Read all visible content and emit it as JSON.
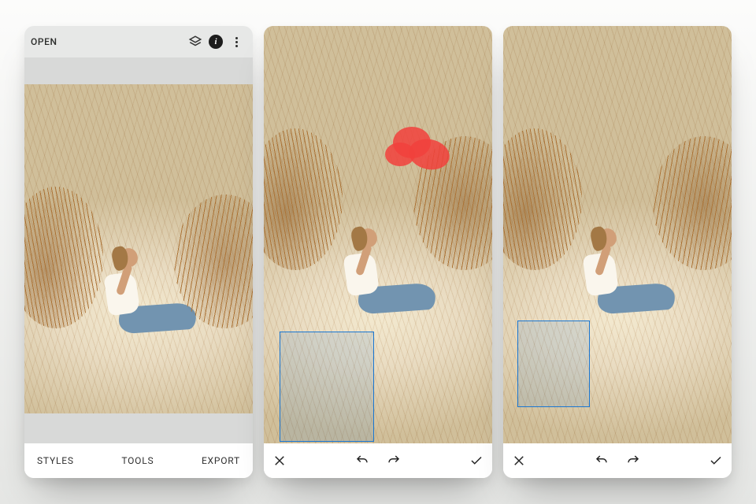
{
  "colors": {
    "mark": "#f1413d",
    "selection_stroke": "#1976d2",
    "selection_fill": "rgba(25,118,210,0.12)"
  },
  "screen1": {
    "header": {
      "open_label": "OPEN",
      "icons": {
        "layers": "layers-icon",
        "info": "info-icon",
        "more": "more-icon"
      }
    },
    "tabs": {
      "styles": "STYLES",
      "tools": "TOOLS",
      "export": "EXPORT"
    }
  },
  "screen2": {
    "compare_icon": "compare-icon",
    "action_bar": {
      "cancel": "close-icon",
      "undo": "undo-icon",
      "redo": "redo-icon",
      "apply": "check-icon"
    }
  },
  "screen3": {
    "compare_icon": "compare-icon",
    "action_bar": {
      "cancel": "close-icon",
      "undo": "undo-icon",
      "redo": "redo-icon",
      "apply": "check-icon"
    }
  }
}
